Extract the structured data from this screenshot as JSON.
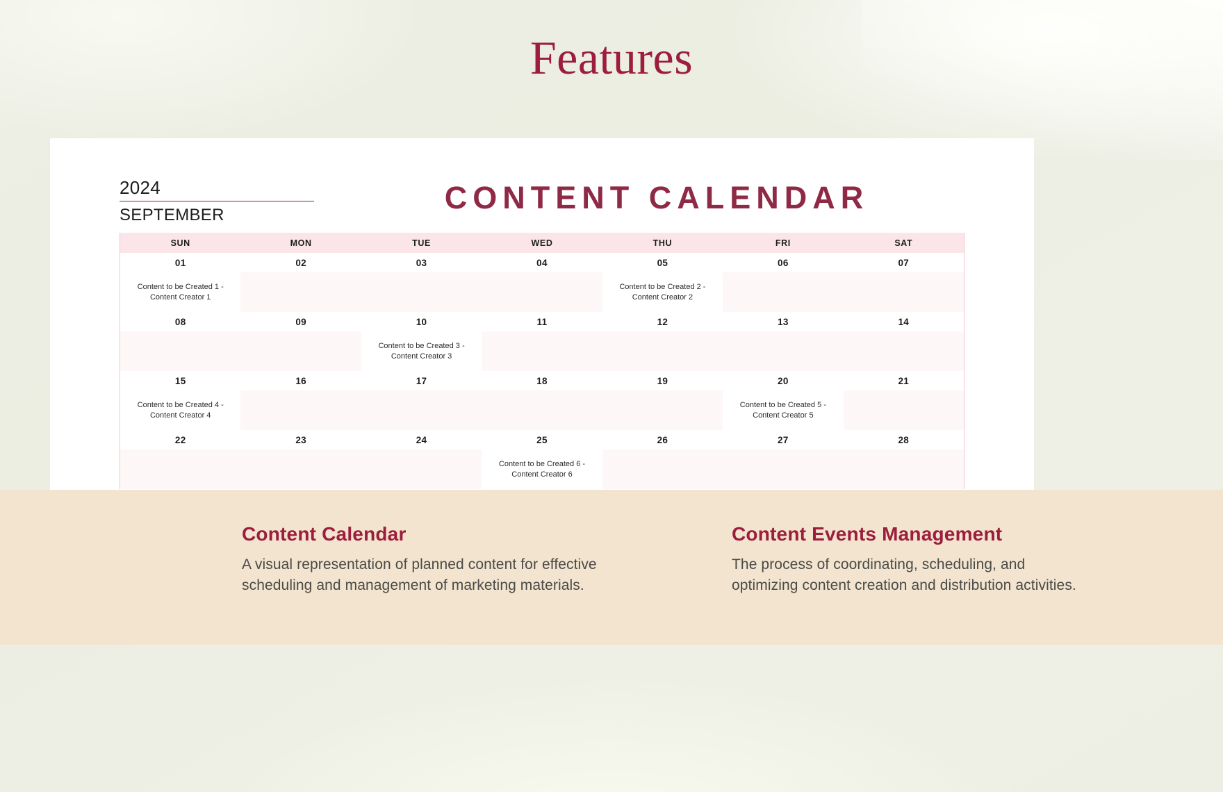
{
  "page": {
    "headline": "Features",
    "bg_color": "#eceee2",
    "accent_color": "#9c1d3d"
  },
  "calendar": {
    "year": "2024",
    "month": "SEPTEMBER",
    "title": "CONTENT CALENDAR",
    "header_bg": "#fbe5e9",
    "day_headers": [
      "SUN",
      "MON",
      "TUE",
      "WED",
      "THU",
      "FRI",
      "SAT"
    ],
    "weeks": [
      {
        "dates": [
          "01",
          "02",
          "03",
          "04",
          "05",
          "06",
          "07"
        ],
        "entries": [
          "Content to be Created 1 - Content Creator 1",
          "",
          "",
          "",
          "Content to be Created 2 - Content Creator 2",
          "",
          ""
        ]
      },
      {
        "dates": [
          "08",
          "09",
          "10",
          "11",
          "12",
          "13",
          "14"
        ],
        "entries": [
          "",
          "",
          "Content to be Created 3 - Content Creator 3",
          "",
          "",
          "",
          ""
        ]
      },
      {
        "dates": [
          "15",
          "16",
          "17",
          "18",
          "19",
          "20",
          "21"
        ],
        "entries": [
          "Content to be Created 4 - Content Creator 4",
          "",
          "",
          "",
          "",
          "Content to be Created 5 - Content Creator 5",
          ""
        ]
      },
      {
        "dates": [
          "22",
          "23",
          "24",
          "25",
          "26",
          "27",
          "28"
        ],
        "entries": [
          "",
          "",
          "",
          "Content to be Created 6 - Content Creator 6",
          "",
          "",
          ""
        ]
      }
    ]
  },
  "features": {
    "band_bg": "#f2e4ce",
    "items": [
      {
        "heading": "Content Calendar",
        "body": "A visual representation of planned content for effective scheduling and management of marketing materials."
      },
      {
        "heading": "Content Events Management",
        "body": "The process of coordinating, scheduling, and optimizing content creation and distribution activities."
      }
    ]
  }
}
